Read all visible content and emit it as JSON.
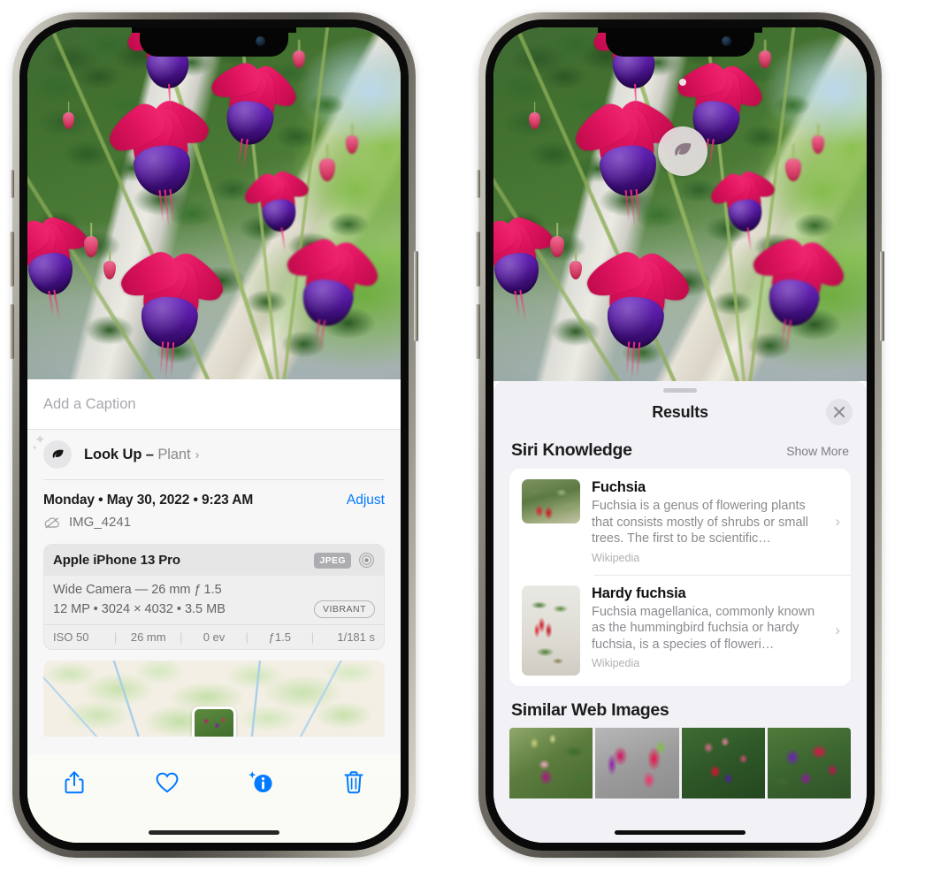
{
  "left_phone": {
    "photo": {
      "alt": "fuchsia-flowers-photo"
    },
    "caption": {
      "placeholder": "Add a Caption",
      "value": ""
    },
    "lookup": {
      "icon": "leaf-icon",
      "sparkle": "✦",
      "label": "Look Up – ",
      "subject": "Plant",
      "chevron": "›"
    },
    "meta": {
      "date": "Monday • May 30, 2022 • 9:23 AM",
      "adjust_label": "Adjust",
      "cloud_icon": "icloud-slash-icon",
      "filename": "IMG_4241"
    },
    "exif": {
      "device": "Apple iPhone 13 Pro",
      "format_badge": "JPEG",
      "aperture_icon": "aperture-icon",
      "lens_line": "Wide Camera — 26 mm ƒ 1.5",
      "size_line": "12 MP • 3024 × 4032 • 3.5 MB",
      "style_badge": "VIBRANT",
      "stats": [
        "ISO 50",
        "26 mm",
        "0 ev",
        "ƒ1.5",
        "1/181 s"
      ],
      "separator": "|"
    },
    "map": {
      "name": "location-map-thumbnail",
      "pin": "photo-pin"
    },
    "toolbar": [
      {
        "name": "share-button",
        "icon": "share-icon"
      },
      {
        "name": "favorite-button",
        "icon": "heart-icon"
      },
      {
        "name": "info-button",
        "icon": "info-sparkle-icon"
      },
      {
        "name": "delete-button",
        "icon": "trash-icon"
      }
    ]
  },
  "right_phone": {
    "photo": {
      "alt": "fuchsia-flowers-photo"
    },
    "vlu_badge": {
      "icon": "leaf-icon",
      "name": "visual-look-up-badge"
    },
    "sheet": {
      "title": "Results",
      "close_label": "✕"
    },
    "siri_knowledge": {
      "section_title": "Siri Knowledge",
      "show_more": "Show More",
      "chevron": "›",
      "items": [
        {
          "title": "Fuchsia",
          "description": "Fuchsia is a genus of flowering plants that consists mostly of shrubs or small trees. The first to be scientific…",
          "source": "Wikipedia",
          "thumb": "fuchsia-red-flowers-thumb"
        },
        {
          "title": "Hardy fuchsia",
          "description": "Fuchsia magellanica, commonly known as the hummingbird fuchsia or hardy fuchsia, is a species of floweri…",
          "source": "Wikipedia",
          "thumb": "hardy-fuchsia-branch-thumb"
        }
      ]
    },
    "similar_web_images": {
      "section_title": "Similar Web Images",
      "thumbs": [
        "pink-white-fuchsia-leaves",
        "red-magenta-fuchsia-closeup",
        "red-fuchsia-bush",
        "purple-magenta-fuchsia-cluster"
      ]
    }
  },
  "colors": {
    "accent_blue": "#007aff",
    "sheet_bg": "#f7f7f7",
    "results_bg": "#f2f1f6",
    "card_bg": "#ffffff",
    "text_primary": "#1c1c1e",
    "text_secondary": "#8b8b90"
  }
}
